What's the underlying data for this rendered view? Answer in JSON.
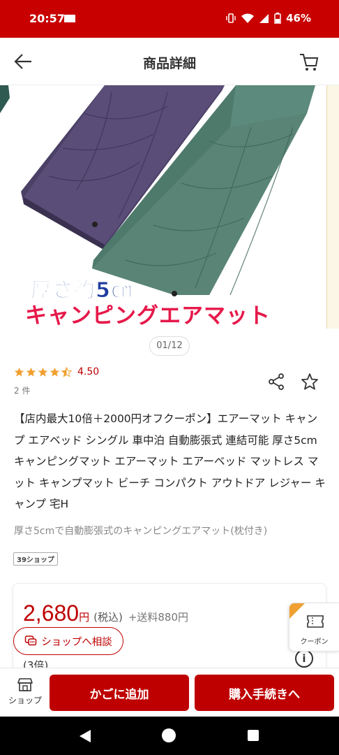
{
  "status_bar": {
    "time": "20:57",
    "battery": "46%",
    "icons": [
      "mail-icon",
      "vibrate-icon",
      "wifi-icon",
      "signal-icon",
      "battery-icon"
    ]
  },
  "header": {
    "title": "商品詳細",
    "back_icon": "arrow-left-icon",
    "cart_icon": "cart-icon"
  },
  "gallery": {
    "caption_line1": "厚さ約5㎝",
    "caption_line2": "キャンピングエアマット",
    "pager": "01/12"
  },
  "rating": {
    "value": "4.50",
    "stars": 4.5,
    "review_count": "2 件"
  },
  "product": {
    "title": "【店内最大10倍＋2000円オフクーポン】エアーマット キャンプ エアベッド シングル 車中泊 自動膨張式 連結可能 厚さ5cm キャンピングマット エアーマット エアーベッド マットレス マット キャンプマット ビーチ コンパクト アウトドア レジャー キャンプ 宅H",
    "subtitle": "厚さ5cmで自動膨張式のキャンピングエアマット(枕付き)",
    "shop_tag": "39ショップ"
  },
  "price": {
    "value": "2,680",
    "unit": "円",
    "tax": "(税込)",
    "shipping": "+送料880円",
    "points": "(3倍)"
  },
  "floating": {
    "consult_label": "ショップへ相談",
    "coupon_label": "クーポン"
  },
  "bottom_bar": {
    "shop_label": "ショップ",
    "add_cart_label": "かごに追加",
    "checkout_label": "購入手続きへ"
  },
  "colors": {
    "brand_red": "#bf0000",
    "status_bar": "#c80000",
    "star": "#f0a030"
  }
}
